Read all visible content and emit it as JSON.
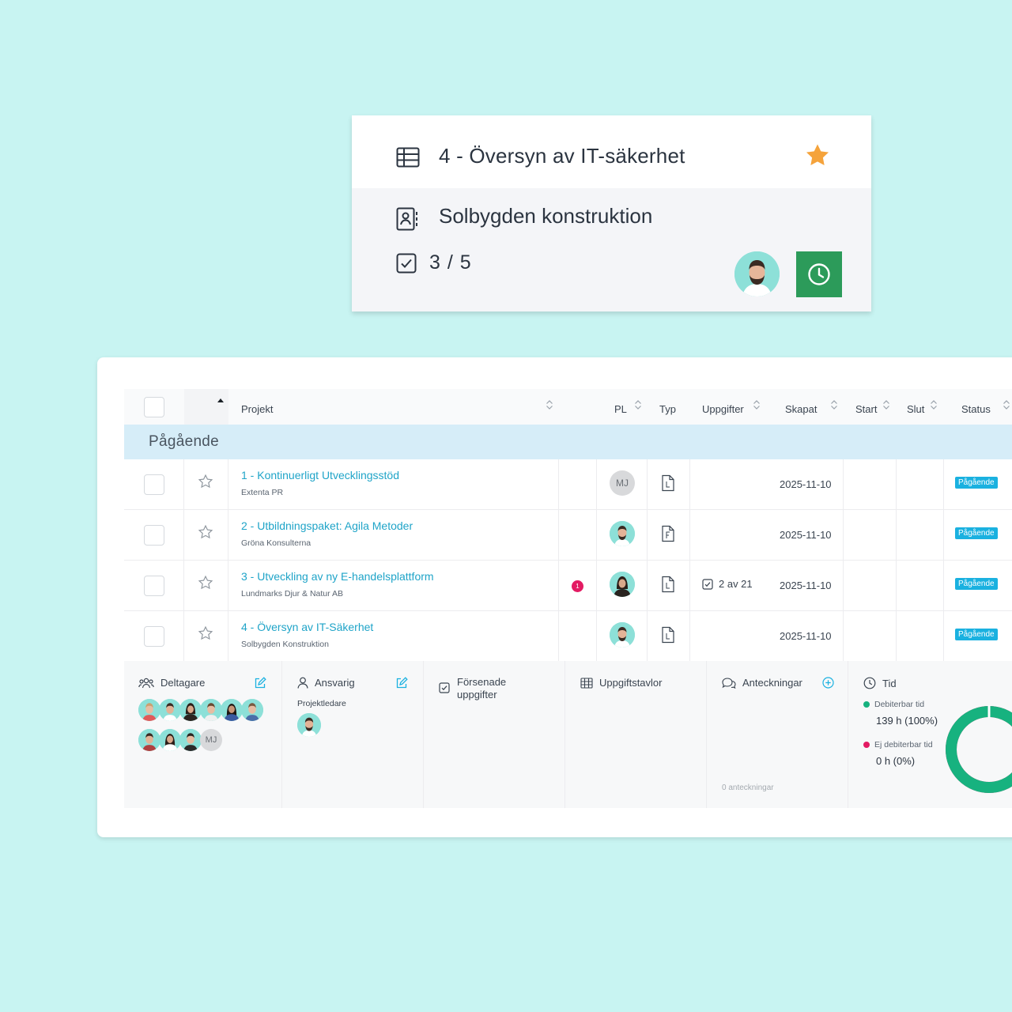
{
  "card": {
    "title": "4 - Översyn av IT-säkerhet",
    "client": "Solbygden konstruktion",
    "task_count": "3 / 5",
    "icons": {
      "board": "table-icon",
      "client": "contact-book-icon",
      "tasks": "checkbox-icon",
      "favorite": "star-icon",
      "timer": "clock-icon"
    },
    "star_color": "#f5a33b",
    "timer_color": "#2c9b5a"
  },
  "table": {
    "columns": [
      "Projekt",
      "PL",
      "Typ",
      "Uppgifter",
      "Skapat",
      "Start",
      "Slut",
      "Status"
    ],
    "group_label": "Pågående",
    "rows": [
      {
        "name": "1 - Kontinuerligt Utvecklingsstöd",
        "client": "Extenta PR",
        "pl": "MJ",
        "created": "2025-11-10",
        "status": "Pågående",
        "tasks": "",
        "notifications": ""
      },
      {
        "name": "2 - Utbildningspaket: Agila Metoder",
        "client": "Gröna Konsulterna",
        "pl": "",
        "created": "2025-11-10",
        "status": "Pågående",
        "tasks": "",
        "notifications": ""
      },
      {
        "name": "3 - Utveckling av ny E-handelsplattform",
        "client": "Lundmarks Djur & Natur AB",
        "pl": "",
        "created": "2025-11-10",
        "status": "Pågående",
        "tasks": "2 av 21",
        "notifications": "1"
      },
      {
        "name": "4 - Översyn av IT-Säkerhet",
        "client": "Solbygden Konstruktion",
        "pl": "",
        "created": "2025-11-10",
        "status": "Pågående",
        "tasks": "",
        "notifications": ""
      }
    ],
    "status_color": "#1ab1e0",
    "link_color": "#1fa4c8"
  },
  "details": {
    "participants_title": "Deltagare",
    "participants_extra": "MJ",
    "responsible_title": "Ansvarig",
    "responsible_role": "Projektledare",
    "delayed_title": "Försenade uppgifter",
    "boards_title": "Uppgiftstavlor",
    "notes_title": "Anteckningar",
    "notes_count": "0 anteckningar",
    "time_title": "Tid",
    "billable_label": "Debiterbar tid",
    "billable_value": "139 h (100%)",
    "nonbillable_label": "Ej debiterbar tid",
    "nonbillable_value": "0 h (0%)",
    "billable_fraction": 1.0,
    "billable_color": "#17b27f",
    "nonbillable_color": "#e31b63"
  }
}
